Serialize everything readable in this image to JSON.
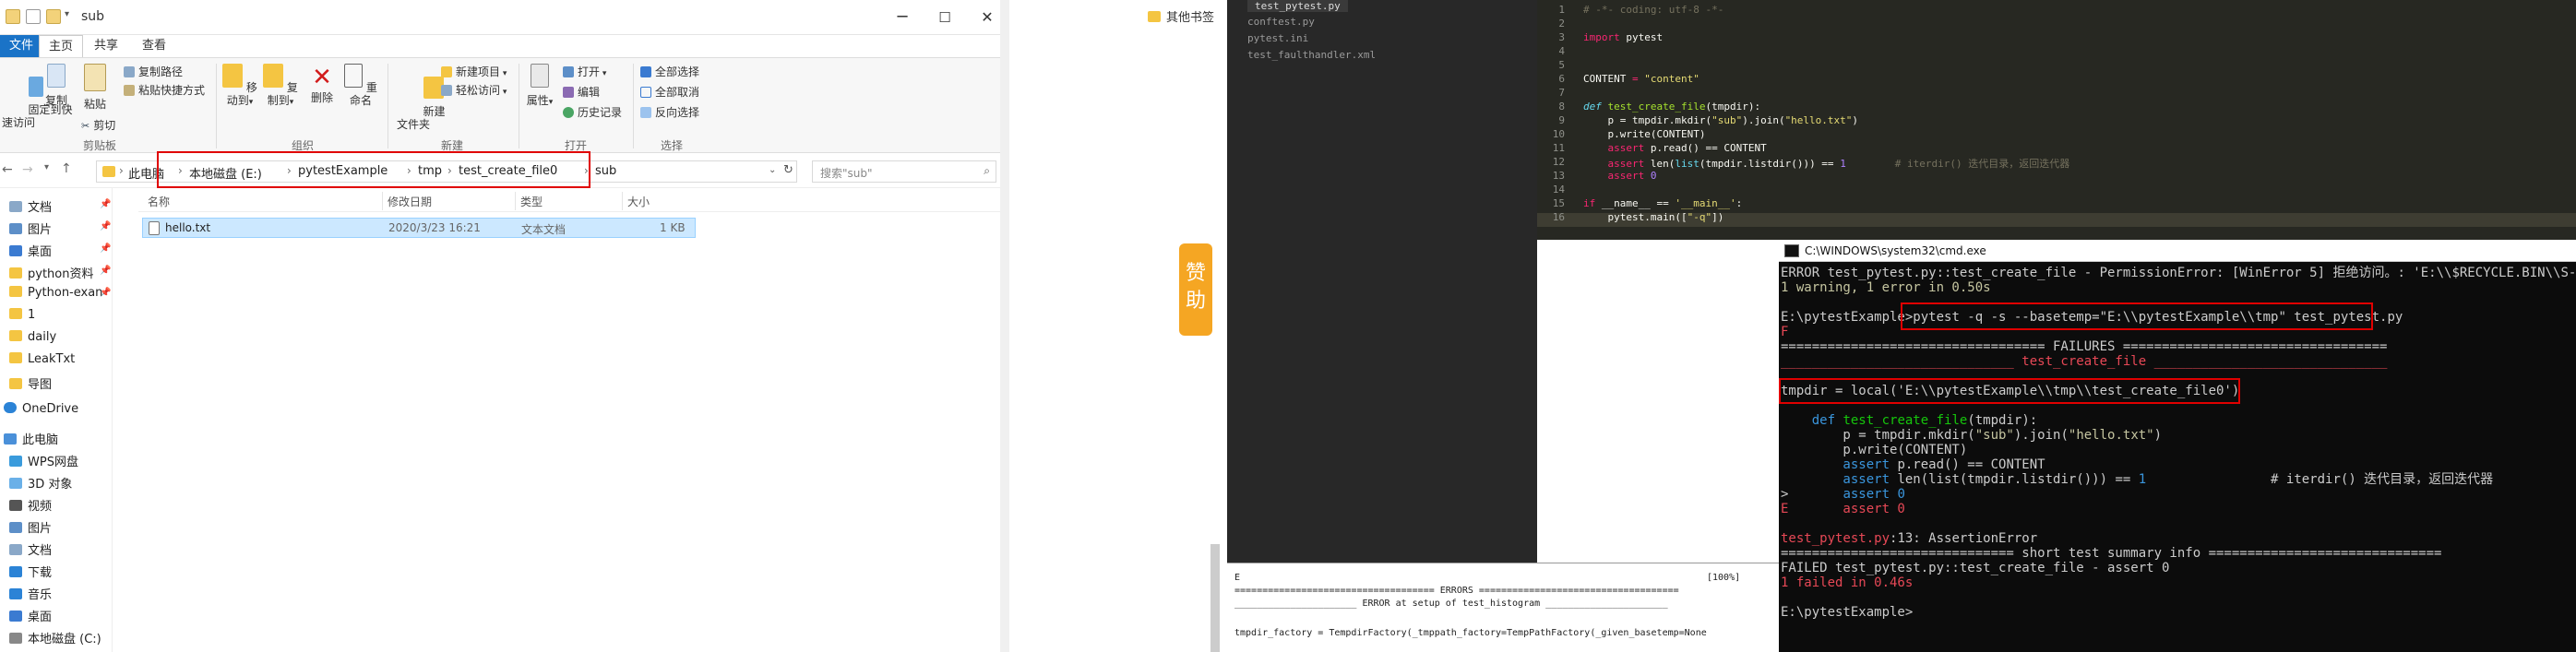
{
  "explorer": {
    "title": "sub",
    "window_controls": {
      "minimize": "─",
      "maximize": "☐",
      "close": "✕"
    },
    "tabs": [
      "文件",
      "主页",
      "共享",
      "查看"
    ],
    "ribbon": {
      "pin_label": "固定到快\n速访问",
      "copy": "复制",
      "paste": "粘贴",
      "copy_path": "复制路径",
      "paste_shortcut": "粘贴快捷方式",
      "cut": "剪切",
      "group_clipboard": "剪贴板",
      "move_to": "移动到",
      "copy_to": "复制到",
      "delete": "删除",
      "rename": "重命名",
      "group_organize": "组织",
      "new_folder": "新建\n文件夹",
      "new_item": "新建项目",
      "easy_access": "轻松访问",
      "group_new": "新建",
      "properties": "属性",
      "open": "打开",
      "edit": "编辑",
      "history": "历史记录",
      "group_open": "打开",
      "select_all": "全部选择",
      "select_none": "全部取消",
      "invert_selection": "反向选择",
      "group_select": "选择"
    },
    "breadcrumbs": [
      "此电脑",
      "本地磁盘 (E:)",
      "pytestExample",
      "tmp",
      "test_create_file0",
      "sub"
    ],
    "search_placeholder": "搜索\"sub\"",
    "nav": [
      "文档",
      "图片",
      "桌面",
      "python资料",
      "Python-exan",
      "1",
      "daily",
      "LeakTxt",
      "导图",
      "OneDrive",
      "此电脑",
      "WPS网盘",
      "3D 对象",
      "视频",
      "图片",
      "文档",
      "下载",
      "音乐",
      "桌面",
      "本地磁盘 (C:)"
    ],
    "columns": [
      "名称",
      "修改日期",
      "类型",
      "大小"
    ],
    "files": [
      {
        "name": "hello.txt",
        "modified": "2020/3/23 16:21",
        "type": "文本文档",
        "size": "1 KB"
      }
    ]
  },
  "browser": {
    "bookmark": "其他书签",
    "side_tab": "赞\n助"
  },
  "editor": {
    "files": [
      "test_pytest.py",
      "conftest.py",
      "pytest.ini",
      "test_faulthandler.xml"
    ],
    "line_numbers": [
      "1",
      "2",
      "3",
      "4",
      "5",
      "6",
      "7",
      "8",
      "9",
      "10",
      "11",
      "12",
      "13",
      "14",
      "15",
      "16"
    ],
    "code": {
      "l1": "# -*- coding: utf-8 -*-",
      "l3_kw": "import",
      "l3_rest": " pytest",
      "l6_name": "CONTENT",
      "l6_eq": " = ",
      "l6_str": "\"content\"",
      "l8_kw": "def",
      "l8_fn": " test_create_file",
      "l8_rest": "(tmpdir):",
      "l9_a": "    p = tmpdir.mkdir(",
      "l9_s1": "\"sub\"",
      "l9_b": ").join(",
      "l9_s2": "\"hello.txt\"",
      "l9_c": ")",
      "l10": "    p.write(CONTENT)",
      "l11_kw": "    assert",
      "l11_rest": " p.read() == CONTENT",
      "l12_kw": "    assert",
      "l12_a": " len(",
      "l12_bi": "list",
      "l12_b": "(tmpdir.listdir())) == ",
      "l12_num": "1",
      "l12_cm": "        # iterdir() 迭代目录，返回迭代器",
      "l13_kw": "    assert",
      "l13_num": " 0",
      "l15_kw": "if",
      "l15_a": " __name__ == ",
      "l15_s": "'__main__'",
      "l15_b": ":",
      "l16_a": "    pytest.main([",
      "l16_s": "\"-q\"",
      "l16_b": "])"
    }
  },
  "bottom_terminal": {
    "l1_left": "E",
    "l1_right": "[100%]",
    "l2": "==================================== ERRORS ====================================",
    "l3": "______________________ ERROR at setup of test_histogram ______________________",
    "l4": "tmpdir_factory = TempdirFactory(_tmppath_factory=TempPathFactory(_given_basetemp=None"
  },
  "cmd": {
    "title": "C:\\WINDOWS\\system32\\cmd.exe",
    "lines": {
      "l1": "ERROR test_pytest.py::test_create_file - PermissionError: [WinError 5] 拒绝访问。: 'E:\\\\$RECYCLE.BIN\\\\S-1-5-",
      "l2": "1 warning, 1 error in 0.50s",
      "l4_prompt": "E:\\pytestExample>",
      "l4_cmd": "pytest -q -s --basetemp=\"E:\\\\pytestExample\\\\tmp\" test_pytest.py",
      "l5": "F",
      "l6": "================================== FAILURES ==================================",
      "l7": "______________________________ test_create_file ______________________________",
      "l9": "tmpdir = local('E:\\\\pytestExample\\\\tmp\\\\test_create_file0')",
      "l11_kw": "    def",
      "l11_fn": " test_create_file",
      "l11_rest": "(tmpdir):",
      "l12_a": "        p = tmpdir.mkdir(",
      "l12_s1": "\"sub\"",
      "l12_b": ").join(",
      "l12_s2": "\"hello.txt\"",
      "l12_c": ")",
      "l13": "        p.write(CONTENT)",
      "l14_kw": "        assert",
      "l14_rest": " p.read() == CONTENT",
      "l15_kw": "        assert",
      "l15_a": " len(list(tmpdir.listdir())) == ",
      "l15_num": "1",
      "l15_cm": "                # iterdir() 迭代目录，返回迭代器",
      "l16_a": ">       ",
      "l16_kw": "assert",
      "l16_num": " 0",
      "l17": "E       assert 0",
      "l19_file": "test_pytest.py",
      "l19_rest": ":13: AssertionError",
      "l20": "============================== short test summary info ==============================",
      "l21": "FAILED test_pytest.py::test_create_file - assert 0",
      "l22": "1 failed in 0.46s",
      "l24": "E:\\pytestExample>"
    }
  },
  "colors": {
    "accent": "#1a73c7",
    "highlight_red": "#e00000",
    "editor_bg": "#272822",
    "cmd_bg": "#0c0c0c",
    "side_tab": "#f5a623"
  }
}
